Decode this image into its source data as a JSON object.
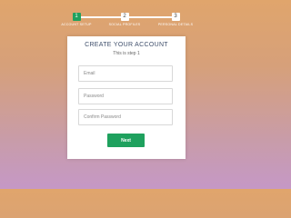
{
  "progress": {
    "completed_fraction": 0.0,
    "steps": [
      {
        "number": "1",
        "label": "ACCOUNT SETUP",
        "active": true
      },
      {
        "number": "2",
        "label": "SOCIAL PROFILES",
        "active": false
      },
      {
        "number": "3",
        "label": "PERSONAL DETAILS",
        "active": false
      }
    ]
  },
  "form": {
    "title": "CREATE YOUR ACCOUNT",
    "subtitle": "This is step 1",
    "email_placeholder": "Email",
    "email_value": "",
    "password_placeholder": "Password",
    "password_value": "",
    "confirm_placeholder": "Confirm Password",
    "confirm_value": "",
    "next_label": "Next"
  },
  "colors": {
    "accent": "#1fa15e",
    "background_top": "#e0a56c",
    "background_bottom": "#c598c6",
    "title": "#3f4f6b"
  }
}
